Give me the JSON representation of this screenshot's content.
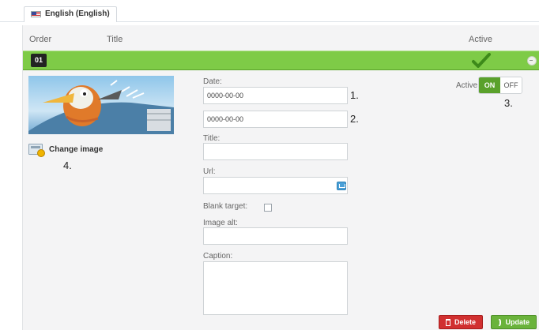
{
  "language_tab": {
    "label": "English (English)",
    "icon": "uk-flag-icon"
  },
  "table_header": {
    "order": "Order",
    "title": "Title",
    "active": "Active"
  },
  "row": {
    "order": "01",
    "active_icon": "green-checkmark-icon",
    "change_image_label": "Change image",
    "annotations": {
      "date_1": "1.",
      "date_2": "2.",
      "toggle": "3.",
      "change_image": "4."
    },
    "fields": {
      "date_label": "Date:",
      "date_from_value": "0000-00-00",
      "date_to_value": "0000-00-00",
      "title_label": "Title:",
      "title_value": "",
      "url_label": "Url:",
      "url_value": "",
      "blank_target_label": "Blank target:",
      "blank_target_checked": false,
      "image_alt_label": "Image alt:",
      "image_alt_value": "",
      "caption_label": "Caption:",
      "caption_value": ""
    },
    "active_toggle": {
      "label": "Active:",
      "on_label": "ON",
      "off_label": "OFF",
      "state": "ON"
    }
  },
  "actions": {
    "delete_label": "Delete",
    "update_label": "Update"
  },
  "colors": {
    "green_bar": "#7ecb47",
    "toggle_on": "#5aa12b",
    "delete": "#d13030",
    "update": "#6ab33b"
  }
}
